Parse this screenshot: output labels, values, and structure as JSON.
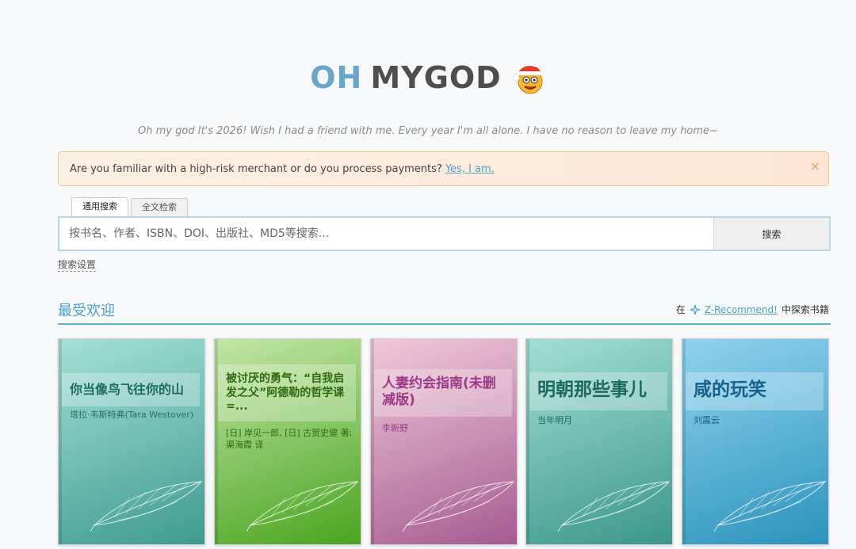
{
  "logo": {
    "part1": "OH",
    "part2": "MYGOD"
  },
  "tagline": "Oh my god It's 2026! Wish I had a friend with me. Every year I'm all alone. I have no reason to leave my home~",
  "notice": {
    "text": "Are you familiar with a high-risk merchant or do you process payments?",
    "link": "Yes, I am.",
    "close": "×"
  },
  "tabs": [
    {
      "label": "通用搜索"
    },
    {
      "label": "全文检索"
    }
  ],
  "search": {
    "placeholder": "按书名、作者、ISBN、DOI、出版社、MD5等搜索...",
    "button": "搜索"
  },
  "search_settings": "搜索设置",
  "popular": {
    "title": "最受欢迎",
    "prefix": "在",
    "link": "Z-Recommend!",
    "suffix": "中探索书籍"
  },
  "books": [
    {
      "title": "你当像鸟飞往你的山",
      "author": "塔拉·韦斯特弗(Tara Westover)",
      "title_color": "#1e6a63",
      "author_color": "#2d6e68"
    },
    {
      "title": "被讨厌的勇气：“自我启发之父”阿德勒的哲学课 =...",
      "author": "[日] 岸见一郎, [日] 古贺史健 著; 渠海霞 译",
      "title_color": "#2f6b12",
      "author_color": "#2f6b12"
    },
    {
      "title": "人妻约会指南(未删减版)",
      "author": "李新野",
      "title_color": "#9c3a86",
      "author_color": "#9c3a86"
    },
    {
      "title": "明朝那些事儿",
      "author": "当年明月",
      "title_color": "#1c6a60",
      "author_color": "#1c6a60"
    },
    {
      "title": "咸的玩笑",
      "author": "刘震云",
      "title_color": "#17628a",
      "author_color": "#17628a"
    }
  ]
}
